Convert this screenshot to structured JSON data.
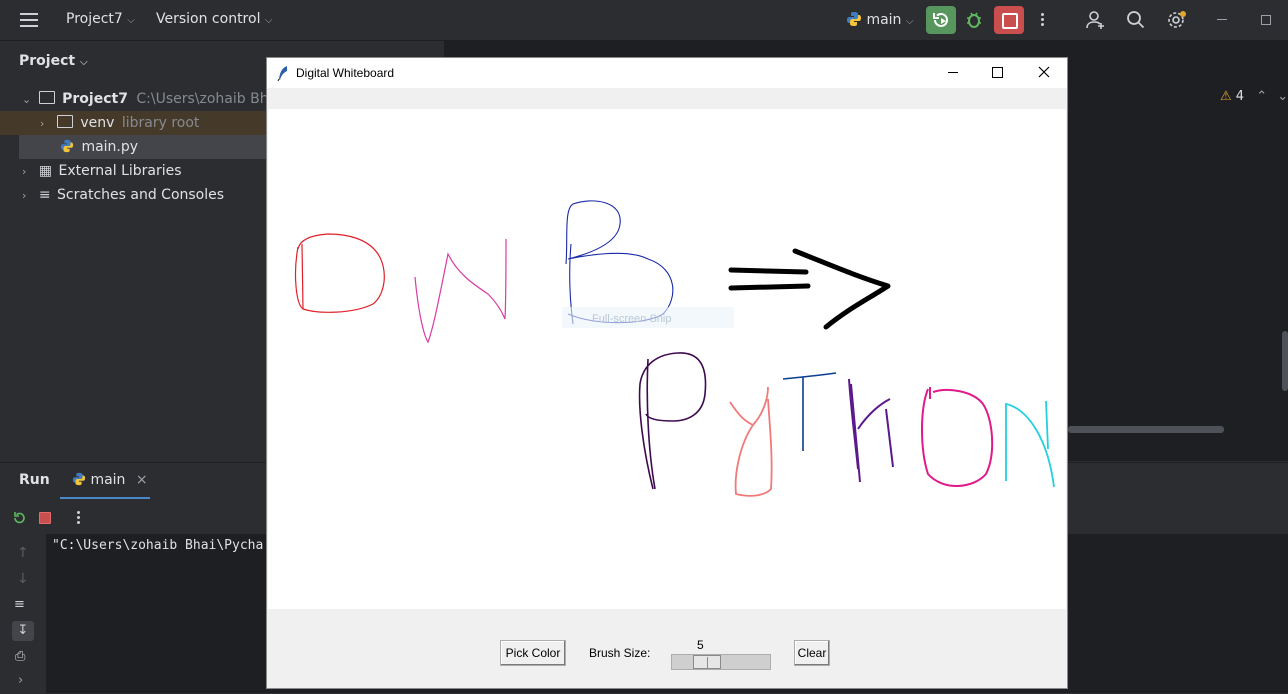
{
  "ide": {
    "project_name": "Project7",
    "vcs_label": "Version control",
    "branch_label": "main",
    "project_panel_title": "Project",
    "tree": {
      "root_name": "Project7",
      "root_path": "C:\\Users\\zohaib Bhai\\Py",
      "venv_name": "venv",
      "venv_note": "library root",
      "main_file": "main.py",
      "external_libs": "External Libraries",
      "scratches": "Scratches and Consoles"
    },
    "warning_count": "4",
    "run_tab_title": "Run",
    "run_config_tab": "main",
    "console_line": "\"C:\\Users\\zohaib Bhai\\Pycha"
  },
  "whiteboard": {
    "title": "Digital Whiteboard",
    "overlay_text": "Full-screen Snip",
    "pick_color_label": "Pick Color",
    "brush_size_label": "Brush Size:",
    "brush_size_value": "5",
    "brush_size_fraction": 0.27,
    "clear_label": "Clear"
  },
  "colors": {
    "ide_bg": "#2b2d30",
    "editor_bg": "#1e1f22",
    "run_green": "#57965c",
    "stop_red": "#c94f4f",
    "stroke_red": "#e0202a",
    "stroke_pink": "#d93aa3",
    "stroke_navy": "#1a2aa8",
    "stroke_black": "#000000",
    "stroke_purple": "#3d0a4f",
    "stroke_salmon": "#f07a7a",
    "stroke_blue": "#0b3d91",
    "stroke_violet": "#5b1a8c",
    "stroke_magenta": "#e01a8a",
    "stroke_cyan": "#22d0e0"
  },
  "icons": [
    "hamburger-menu-icon",
    "python-icon",
    "rerun-icon",
    "debug-bug-icon",
    "stop-icon",
    "more-vertical-icon",
    "add-user-icon",
    "search-icon",
    "settings-gear-icon",
    "minimize-icon",
    "restore-icon",
    "folder-icon",
    "chevron-right-icon",
    "chevron-down-icon",
    "library-icon",
    "scratches-icon",
    "warning-icon",
    "feather-icon",
    "close-icon",
    "maximize-icon",
    "soft-wrap-icon",
    "scroll-end-icon",
    "print-icon",
    "arrow-up-icon",
    "arrow-down-icon"
  ]
}
